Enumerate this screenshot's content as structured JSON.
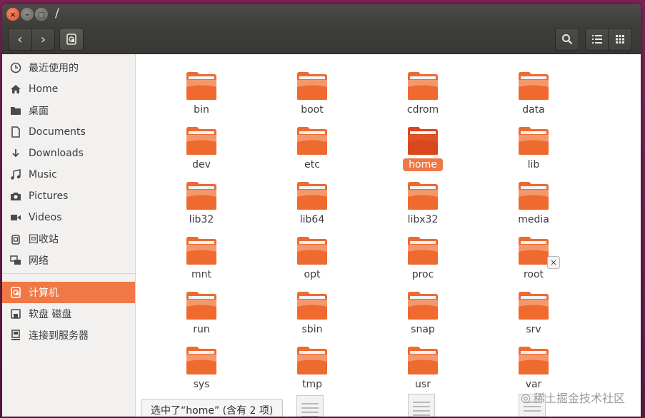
{
  "window": {
    "title": "/"
  },
  "toolbar": {
    "back_glyph": "‹",
    "forward_glyph": "›",
    "location_icon": "computer-icon",
    "search_icon": "search-icon",
    "list_view_icon": "list-view-icon",
    "grid_view_icon": "grid-view-icon"
  },
  "sidebar": {
    "items": [
      {
        "label": "最近使用的",
        "icon": "clock-icon"
      },
      {
        "label": "Home",
        "icon": "home-icon"
      },
      {
        "label": "桌面",
        "icon": "desktop-folder-icon"
      },
      {
        "label": "Documents",
        "icon": "document-icon"
      },
      {
        "label": "Downloads",
        "icon": "download-icon"
      },
      {
        "label": "Music",
        "icon": "music-icon"
      },
      {
        "label": "Pictures",
        "icon": "camera-icon"
      },
      {
        "label": "Videos",
        "icon": "video-icon"
      },
      {
        "label": "回收站",
        "icon": "trash-icon"
      },
      {
        "label": "网络",
        "icon": "network-icon"
      },
      {
        "label": "计算机",
        "icon": "computer-icon",
        "active": true
      },
      {
        "label": "软盘 磁盘",
        "icon": "floppy-icon"
      },
      {
        "label": "连接到服务器",
        "icon": "server-icon"
      }
    ]
  },
  "files": [
    "bin",
    "boot",
    "cdrom",
    "data",
    "dev",
    "etc",
    "home",
    "lib",
    "lib32",
    "lib64",
    "libx32",
    "media",
    "mnt",
    "opt",
    "proc",
    "root",
    "run",
    "sbin",
    "snap",
    "srv",
    "sys",
    "tmp",
    "usr",
    "var"
  ],
  "selected_file": "home",
  "locked_file": "root",
  "status": {
    "text": "选中了“home” (含有 2 项)"
  },
  "watermark": {
    "text": "稀土掘金技术社区"
  },
  "colors": {
    "accent": "#f07746",
    "folder": "#e85a22",
    "titlebar": "#3f3e3a"
  }
}
